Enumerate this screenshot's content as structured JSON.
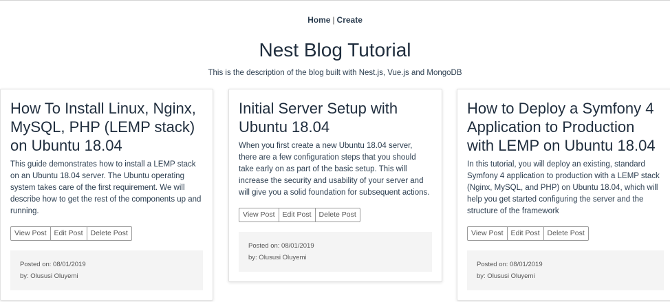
{
  "nav": {
    "home": "Home",
    "separator": "|",
    "create": "Create"
  },
  "header": {
    "title": "Nest Blog Tutorial",
    "description": "This is the description of the blog built with Nest.js, Vue.js and MongoDB"
  },
  "posts": [
    {
      "title": "How To Install Linux, Nginx, MySQL, PHP (LEMP stack) on Ubuntu 18.04",
      "description": "This guide demonstrates how to install a LEMP stack on an Ubuntu 18.04 server. The Ubuntu operating system takes care of the first requirement. We will describe how to get the rest of the components up and running.",
      "view_label": "View Post",
      "edit_label": "Edit Post",
      "delete_label": "Delete Post",
      "posted_on": "Posted on: 08/01/2019",
      "author": "by: Olususi Oluyemi"
    },
    {
      "title": "Initial Server Setup with Ubuntu 18.04",
      "description": "When you first create a new Ubuntu 18.04 server, there are a few configuration steps that you should take early on as part of the basic setup. This will increase the security and usability of your server and will give you a solid foundation for subsequent actions.",
      "view_label": "View Post",
      "edit_label": "Edit Post",
      "delete_label": "Delete Post",
      "posted_on": "Posted on: 08/01/2019",
      "author": "by: Olususi Oluyemi"
    },
    {
      "title": "How to Deploy a Symfony 4 Application to Production with LEMP on Ubuntu 18.04",
      "description": "In this tutorial, you will deploy an existing, standard Symfony 4 application to production with a LEMP stack (Nginx, MySQL, and PHP) on Ubuntu 18.04, which will help you get started configuring the server and the structure of the framework",
      "view_label": "View Post",
      "edit_label": "Edit Post",
      "delete_label": "Delete Post",
      "posted_on": "Posted on: 08/01/2019",
      "author": "by: Olususi Oluyemi"
    }
  ]
}
